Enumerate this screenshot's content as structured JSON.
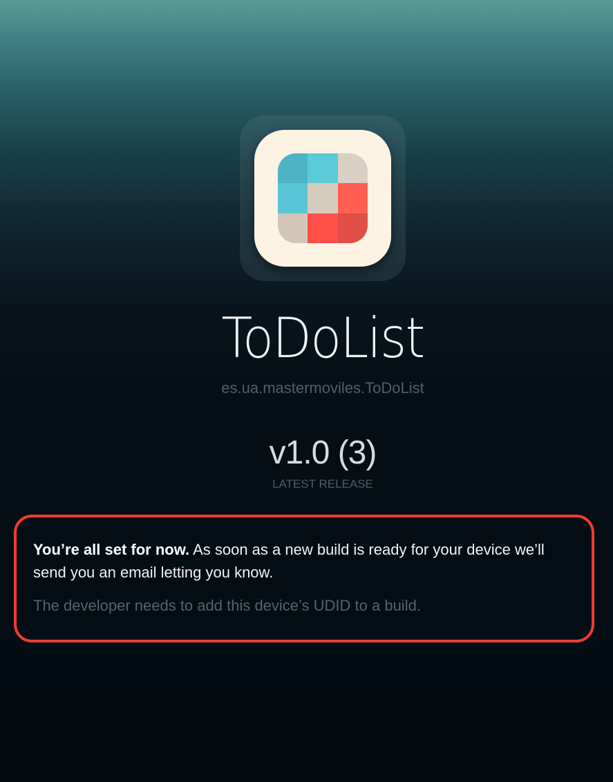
{
  "app": {
    "name": "ToDoList",
    "bundle_id": "es.ua.mastermoviles.ToDoList",
    "version": "v1.0 (3)",
    "release_label": "LATEST RELEASE",
    "icon_name": "todolist-app-icon",
    "icon_colors": [
      "#4fb3c6",
      "#5ccad8",
      "#d9cfc2",
      "#58c6d6",
      "#d6ccbe",
      "#ff5f53",
      "#d2c6b8",
      "#ff4f48",
      "#e04f47"
    ]
  },
  "status": {
    "title": "You’re all set for now.",
    "message": "As soon as a new build is ready for your device we’ll send you an email letting you know.",
    "note": "The developer needs to add this device’s UDID to a build."
  },
  "colors": {
    "highlight_border": "#ef3b36",
    "icon_background": "#fdf3e3"
  }
}
